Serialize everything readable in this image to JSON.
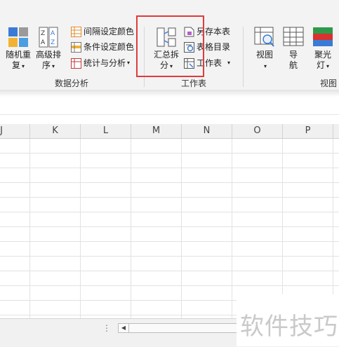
{
  "ribbon": {
    "sort_random": {
      "line1": "随机重",
      "line2": "复",
      "icon": "random-shuffle-icon"
    },
    "sort_advanced": {
      "line1": "高级排",
      "line2": "序",
      "icon": "sort-az-icon"
    },
    "small_left": [
      {
        "label": "间隔设定颜色",
        "icon": "interval-color-icon"
      },
      {
        "label": "条件设定颜色",
        "icon": "condition-color-icon"
      },
      {
        "label": "统计与分析",
        "icon": "stats-analysis-icon"
      }
    ],
    "group_data_analysis": "数据分析",
    "summary_split": {
      "line1": "汇总拆",
      "line2": "分",
      "icon": "summary-split-icon"
    },
    "small_right": [
      {
        "label": "另存本表",
        "icon": "save-sheet-icon"
      },
      {
        "label": "表格目录",
        "icon": "sheet-directory-icon"
      },
      {
        "label": "工作表",
        "icon": "worksheet-icon"
      }
    ],
    "group_worksheet": "工作表",
    "view": {
      "line1": "视图",
      "icon": "view-icon"
    },
    "navigate": {
      "line1": "导",
      "line2": "航",
      "icon": "navigation-icon"
    },
    "spotlight": {
      "line1": "聚光",
      "line2": "灯",
      "icon": "spotlight-icon"
    },
    "group_view": "视图"
  },
  "grid": {
    "columns": [
      "J",
      "K",
      "L",
      "M",
      "N",
      "O",
      "P"
    ]
  },
  "watermark": "软件技巧"
}
